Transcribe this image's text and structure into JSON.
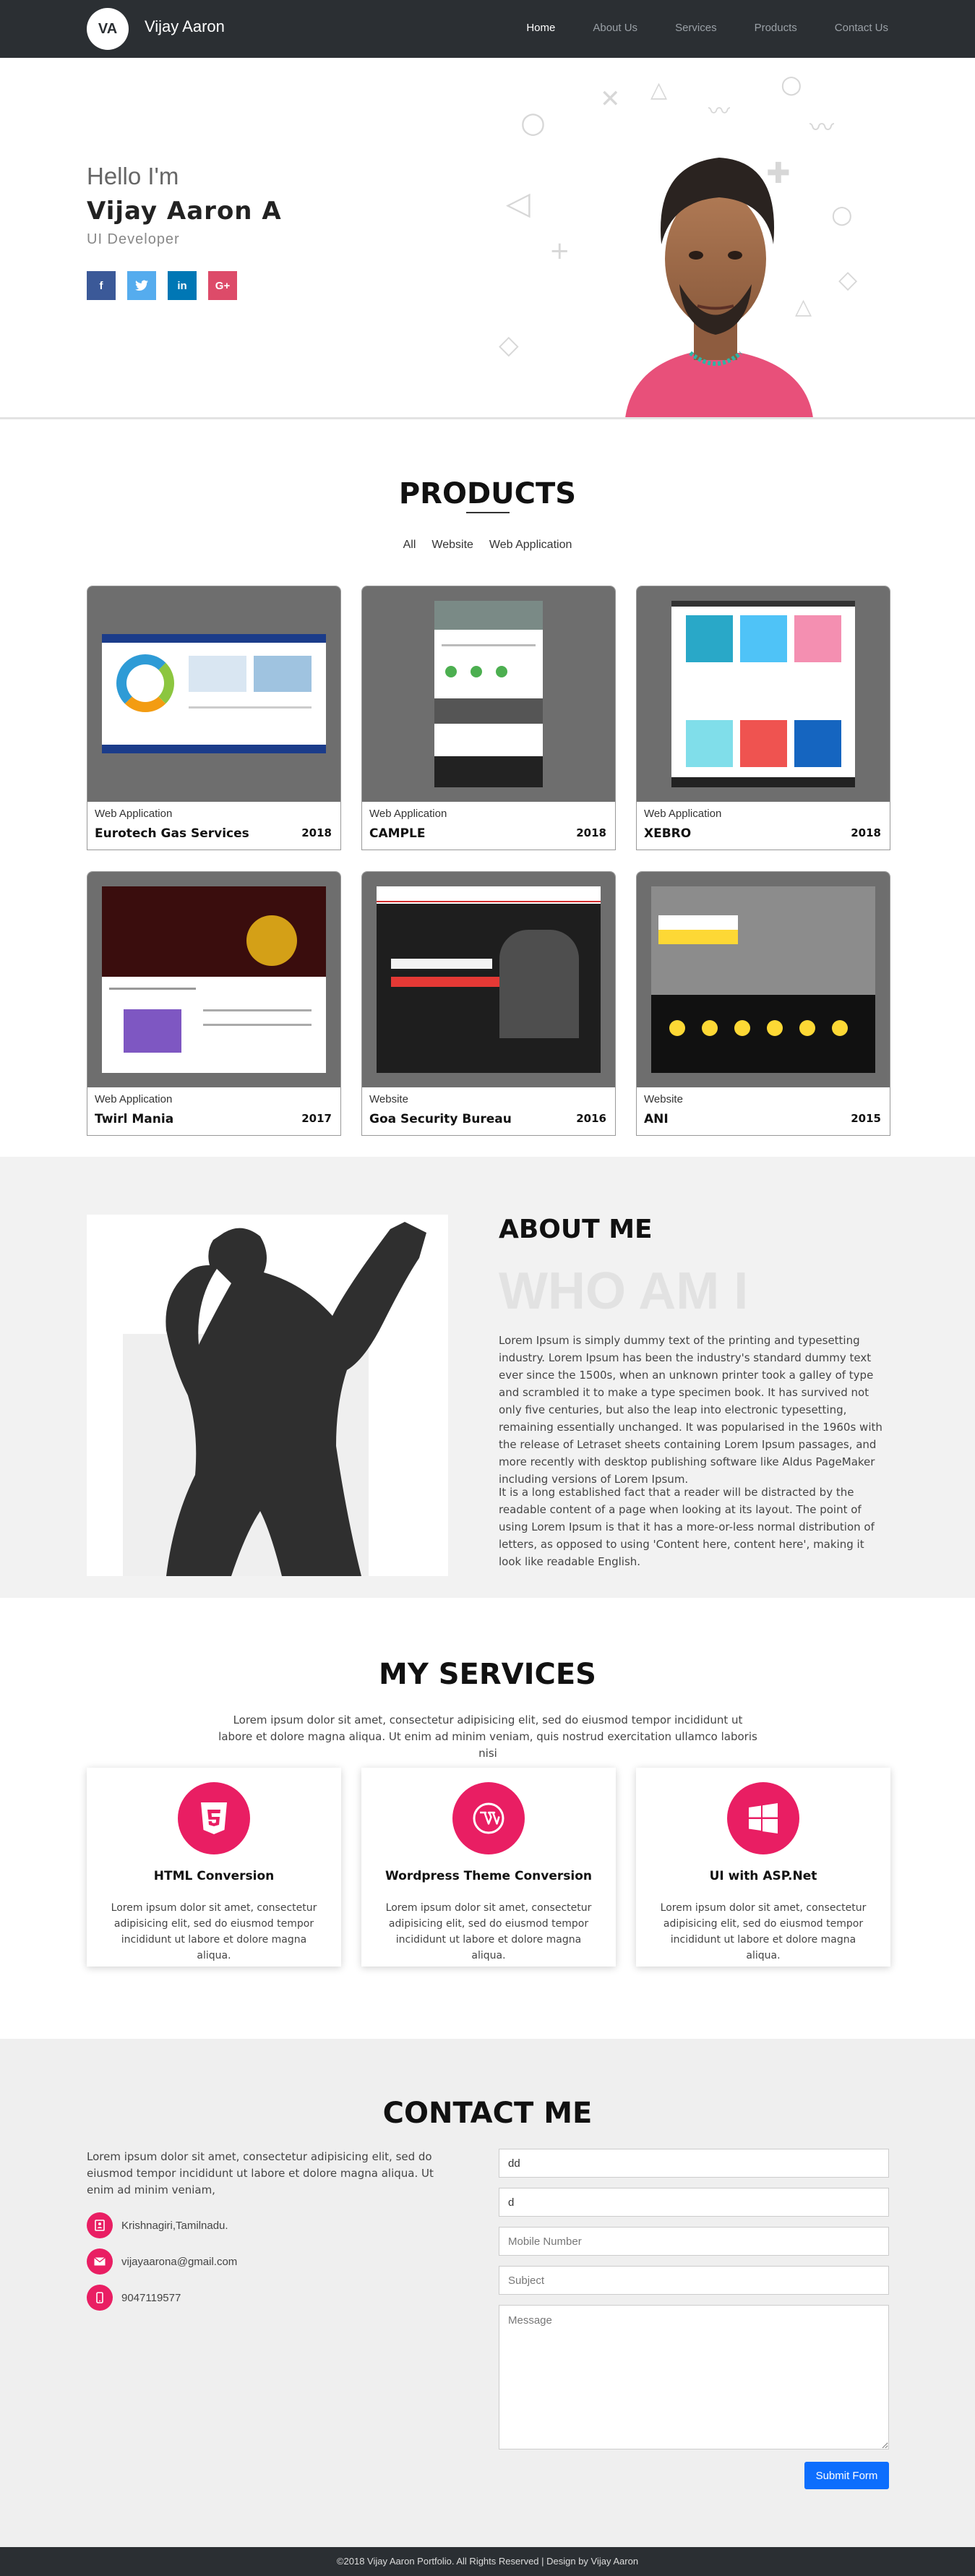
{
  "header": {
    "logo_initials": "VA",
    "brand": "Vijay Aaron",
    "menu": [
      {
        "label": "Home",
        "active": true
      },
      {
        "label": "About Us",
        "active": false
      },
      {
        "label": "Services",
        "active": false
      },
      {
        "label": "Products",
        "active": false
      },
      {
        "label": "Contact Us",
        "active": false
      }
    ]
  },
  "hero": {
    "greeting": "Hello I'm",
    "name": "Vijay Aaron A",
    "role": "UI Developer",
    "socials": [
      {
        "icon": "facebook-icon",
        "glyph": "f",
        "color": "#3b5998"
      },
      {
        "icon": "twitter-icon",
        "glyph": "t",
        "color": "#55acee"
      },
      {
        "icon": "linkedin-icon",
        "glyph": "in",
        "color": "#0077b5"
      },
      {
        "icon": "google-plus-icon",
        "glyph": "G+",
        "color": "#dd4b69"
      }
    ]
  },
  "products": {
    "title": "PRODUCTS",
    "filters": [
      "All",
      "Website",
      "Web Application"
    ],
    "items": [
      {
        "category": "Web Application",
        "name": "Eurotech Gas Services",
        "year": "2018"
      },
      {
        "category": "Web Application",
        "name": "CAMPLE",
        "year": "2018"
      },
      {
        "category": "Web Application",
        "name": "XEBRO",
        "year": "2018"
      },
      {
        "category": "Web Application",
        "name": "Twirl Mania",
        "year": "2017"
      },
      {
        "category": "Website",
        "name": "Goa Security Bureau",
        "year": "2016"
      },
      {
        "category": "Website",
        "name": "ANI",
        "year": "2015"
      }
    ]
  },
  "about": {
    "title": "ABOUT ME",
    "watermark": "WHO AM I",
    "p1": "Lorem Ipsum is simply dummy text of the printing and typesetting industry. Lorem Ipsum has been the industry's standard dummy text ever since the 1500s, when an unknown printer took a galley of type and scrambled it to make a type specimen book. It has survived not only five centuries, but also the leap into electronic typesetting, remaining essentially unchanged. It was popularised in the 1960s with the release of Letraset sheets containing Lorem Ipsum passages, and more recently with desktop publishing software like Aldus PageMaker including versions of Lorem Ipsum.",
    "p2": "It is a long established fact that a reader will be distracted by the readable content of a page when looking at its layout. The point of using Lorem Ipsum is that it has a more-or-less normal distribution of letters, as opposed to using 'Content here, content here', making it look like readable English."
  },
  "services": {
    "title": "MY SERVICES",
    "intro": "Lorem ipsum dolor sit amet, consectetur adipisicing elit, sed do eiusmod tempor incididunt ut labore et dolore magna aliqua. Ut enim ad minim veniam, quis nostrud exercitation ullamco laboris nisi",
    "items": [
      {
        "icon": "html5-icon",
        "title": "HTML Conversion",
        "desc": "Lorem ipsum dolor sit amet, consectetur adipisicing elit, sed do eiusmod tempor incididunt ut labore et dolore magna aliqua."
      },
      {
        "icon": "wordpress-icon",
        "title": "Wordpress Theme Conversion",
        "desc": "Lorem ipsum dolor sit amet, consectetur adipisicing elit, sed do eiusmod tempor incididunt ut labore et dolore magna aliqua."
      },
      {
        "icon": "windows-icon",
        "title": "UI with ASP.Net",
        "desc": "Lorem ipsum dolor sit amet, consectetur adipisicing elit, sed do eiusmod tempor incididunt ut labore et dolore magna aliqua."
      }
    ]
  },
  "contact": {
    "title": "CONTACT ME",
    "intro": "Lorem ipsum dolor sit amet, consectetur adipisicing elit, sed do eiusmod tempor incididunt ut labore et dolore magna aliqua. Ut enim ad minim veniam,",
    "address": "Krishnagiri,Tamilnadu.",
    "email": "vijayaarona@gmail.com",
    "phone": "9047119577",
    "form": {
      "name_value": "dd",
      "email_value": "d",
      "mobile_placeholder": "Mobile Number",
      "subject_placeholder": "Subject",
      "message_placeholder": "Message",
      "submit_label": "Submit Form"
    }
  },
  "footer": {
    "text": "©2018 Vijay Aaron Portfolio. All Rights Reserved | Design by Vijay Aaron"
  },
  "colors": {
    "accent": "#e91e63",
    "nav": "#2b2f33",
    "submit": "#0d6efd"
  }
}
